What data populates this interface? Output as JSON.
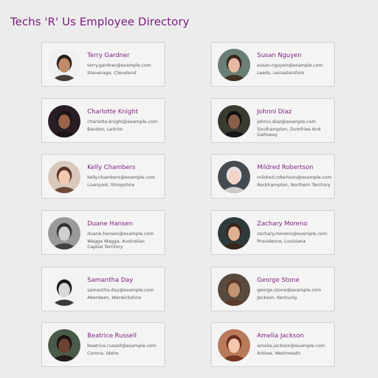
{
  "title": "Techs 'R' Us Employee Directory",
  "employees": [
    {
      "name": "Terry Gardner",
      "email": "terry.gardner@example.com",
      "location": "Stevenage, Cleveland",
      "bg": "#f0f0f0",
      "skin": "#c08a68",
      "hair": "#2a1e18"
    },
    {
      "name": "Susan Nguyen",
      "email": "susan.nguyen@example.com",
      "location": "Leeds, Leicestershire",
      "bg": "#6a7e76",
      "skin": "#e7b9a2",
      "hair": "#3a2418"
    },
    {
      "name": "Charlotte Knight",
      "email": "charlotte.knight@example.com",
      "location": "Bandon, Leitrim",
      "bg": "#2a1e26",
      "skin": "#9a6448",
      "hair": "#1b1414"
    },
    {
      "name": "Johnni Diaz",
      "email": "johnni.diaz@example.com",
      "location": "Southampton, Dumfries And Galloway",
      "bg": "#3a3a30",
      "skin": "#8a6048",
      "hair": "#111111"
    },
    {
      "name": "Kelly Chambers",
      "email": "kelly.chambers@example.com",
      "location": "Liverpool, Shropshire",
      "bg": "#d9c8bc",
      "skin": "#f1c9b0",
      "hair": "#5a3224"
    },
    {
      "name": "Mildred Robertson",
      "email": "mildred.robertson@example.com",
      "location": "Rockhampton, Northern Territory",
      "bg": "#444c52",
      "skin": "#f3d2c8",
      "hair": "#e6e0e0"
    },
    {
      "name": "Duane Hansen",
      "email": "duane.hansen@example.com",
      "location": "Wagga Wagga, Australian Capital Territory",
      "bg": "#9a9a9a",
      "skin": "#cfcfcf",
      "hair": "#333333"
    },
    {
      "name": "Zachary Moreno",
      "email": "zachary.moreno@example.com",
      "location": "Providence, Louisiana",
      "bg": "#2e3a3c",
      "skin": "#e0b092",
      "hair": "#3a2318"
    },
    {
      "name": "Samantha Day",
      "email": "samantha.day@example.com",
      "location": "Aberdeen, Warwickshire",
      "bg": "#f2f2f2",
      "skin": "#d8d8d8",
      "hair": "#1a1a1a"
    },
    {
      "name": "George Stone",
      "email": "george.stone@example.com",
      "location": "Jackson, Kentucky",
      "bg": "#5a4a3e",
      "skin": "#c29474",
      "hair": "#5a3826"
    },
    {
      "name": "Beatrice Russell",
      "email": "beatrice.russell@example.com",
      "location": "Corona, Idaho",
      "bg": "#4a5a48",
      "skin": "#6a4430",
      "hair": "#1a1212"
    },
    {
      "name": "Amelia Jackson",
      "email": "amelia.jackson@example.com",
      "location": "Arklow, Westmeath",
      "bg": "#b87a5a",
      "skin": "#f2c7ae",
      "hair": "#6a2e1c"
    }
  ]
}
